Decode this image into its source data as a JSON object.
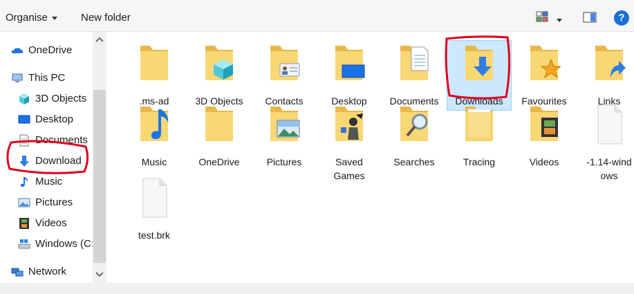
{
  "toolbar": {
    "organise_label": "Organise",
    "new_folder_label": "New folder",
    "help_label": "?"
  },
  "nav": {
    "items": [
      {
        "label": "OneDrive",
        "icon": "cloud-icon"
      },
      {
        "label": "This PC",
        "icon": "computer-icon"
      },
      {
        "label": "3D Objects",
        "icon": "cube-icon"
      },
      {
        "label": "Desktop",
        "icon": "desktop-icon"
      },
      {
        "label": "Documents",
        "icon": "document-icon"
      },
      {
        "label": "Download",
        "icon": "download-arrow-icon"
      },
      {
        "label": "Music",
        "icon": "music-note-icon"
      },
      {
        "label": "Pictures",
        "icon": "picture-icon"
      },
      {
        "label": "Videos",
        "icon": "film-icon"
      },
      {
        "label": "Windows (C:",
        "icon": "drive-icon"
      },
      {
        "label": "Network",
        "icon": "network-icon"
      }
    ]
  },
  "content": {
    "items": [
      {
        "label": ".ms-ad",
        "type": "folder"
      },
      {
        "label": "3D Objects",
        "type": "folder"
      },
      {
        "label": "Contacts",
        "type": "folder"
      },
      {
        "label": "Desktop",
        "type": "folder"
      },
      {
        "label": "Documents",
        "type": "folder"
      },
      {
        "label": "Downloads",
        "type": "folder",
        "selected": true
      },
      {
        "label": "Favourites",
        "type": "folder"
      },
      {
        "label": "Links",
        "type": "folder"
      },
      {
        "label": "Music",
        "type": "folder"
      },
      {
        "label": "OneDrive",
        "type": "folder"
      },
      {
        "label": "Pictures",
        "type": "folder"
      },
      {
        "label": "Saved",
        "label2": "Games",
        "type": "folder"
      },
      {
        "label": "Searches",
        "type": "folder"
      },
      {
        "label": "Tracing",
        "type": "folder"
      },
      {
        "label": "Videos",
        "type": "folder"
      },
      {
        "label": "-1.14-wind",
        "label2": "ows",
        "type": "file"
      },
      {
        "label": "test.brk",
        "type": "file"
      }
    ]
  },
  "colors": {
    "folder": "#f8d775",
    "folder_dark": "#e8b84a",
    "selection": "#cce8ff",
    "annotation_red": "#e0001b",
    "help_blue": "#1a6fd1"
  }
}
